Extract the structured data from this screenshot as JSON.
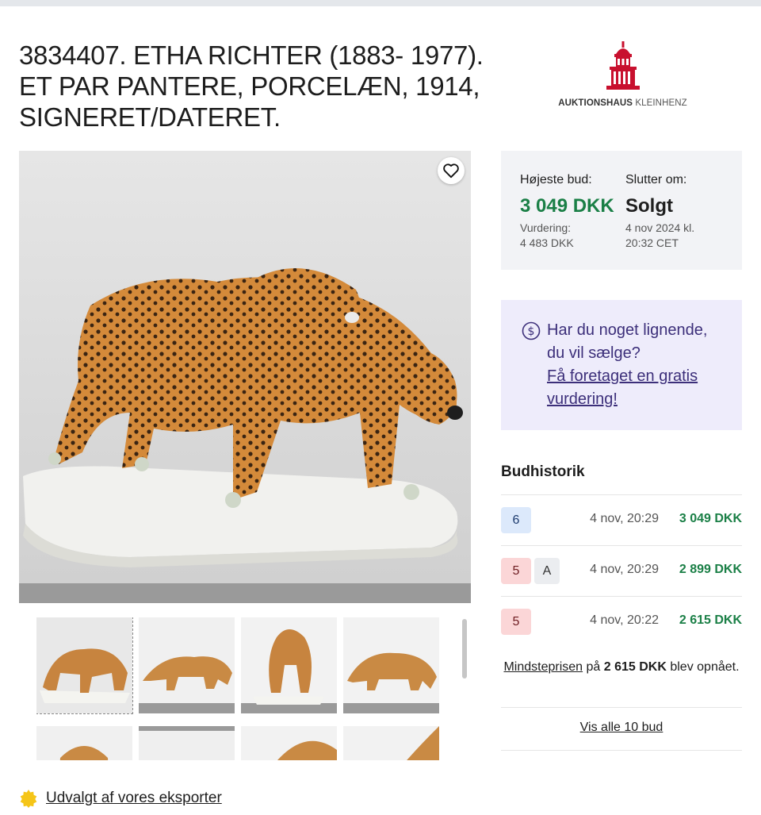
{
  "title": "3834407. ETHA RICHTER (1883- 1977). ET PAR PANTERE, PORCELÆN, 1914, SIGNERET/DATERET.",
  "logo": {
    "bold": "AUKTIONSHAUS",
    "light": "KLEINHENZ"
  },
  "bid_box": {
    "highest_label": "Højeste bud:",
    "highest_value": "3 049 DKK",
    "valuation_label": "Vurdering:",
    "valuation_value": "4 483 DKK",
    "ends_label": "Slutter om:",
    "ends_value": "Solgt",
    "ends_date": "4 nov 2024 kl.",
    "ends_time": "20:32 CET"
  },
  "sell_box": {
    "line1": "Har du noget lignende,",
    "line2": "du vil sælge?",
    "link1": "Få foretaget en gratis",
    "link2": "vurdering!"
  },
  "history": {
    "title": "Budhistorik",
    "rows": [
      {
        "bidder": "6",
        "auto": "",
        "date": "4 nov, 20:29",
        "amount": "3 049 DKK"
      },
      {
        "bidder": "5",
        "auto": "A",
        "date": "4 nov, 20:29",
        "amount": "2 899 DKK"
      },
      {
        "bidder": "5",
        "auto": "",
        "date": "4 nov, 20:22",
        "amount": "2 615 DKK"
      }
    ],
    "min_link": "Mindsteprisen",
    "min_mid": " på ",
    "min_amount": "2 615 DKK",
    "min_tail": " blev opnået.",
    "all_bids": "Vis alle 10 bud"
  },
  "selected_by": "Udvalgt af vores eksporter",
  "colors": {
    "green": "#1a7f46",
    "purple": "#3c2f7a",
    "lavender": "#eeecfb",
    "logo_red": "#c8102e"
  }
}
